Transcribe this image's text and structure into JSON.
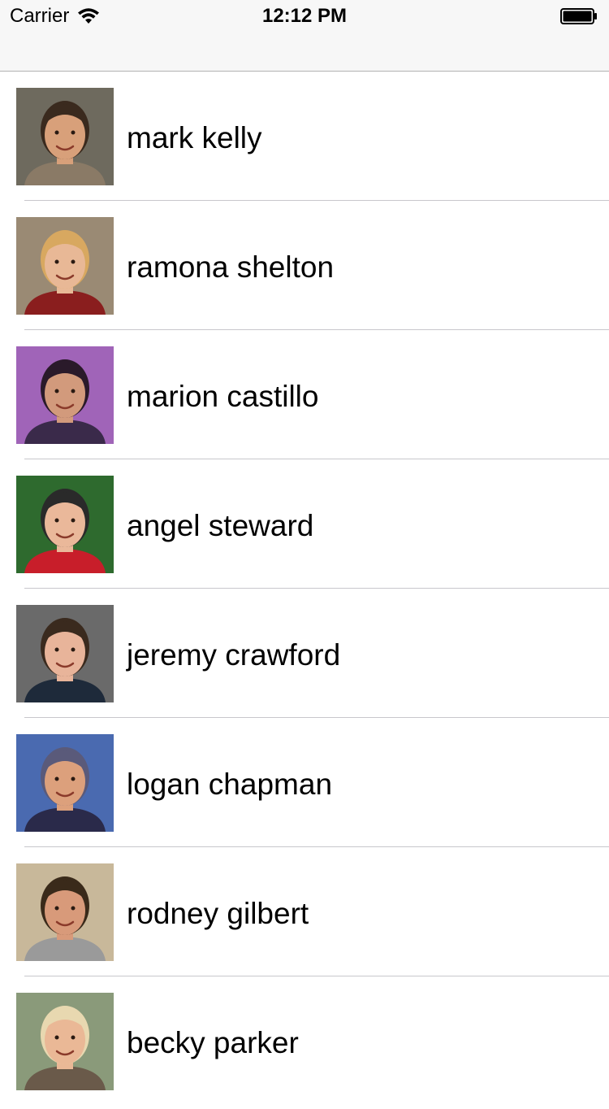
{
  "status_bar": {
    "carrier": "Carrier",
    "time": "12:12 PM"
  },
  "contacts": [
    {
      "name": "mark kelly",
      "bg": "#6e6a5e",
      "skin": "#d8a07a",
      "hair": "#3a2a1e",
      "shirt": "#8a7a66"
    },
    {
      "name": "ramona shelton",
      "bg": "#9a8a74",
      "skin": "#e8b896",
      "hair": "#d8a860",
      "shirt": "#8a1e1e"
    },
    {
      "name": "marion castillo",
      "bg": "#a064b8",
      "skin": "#d29a7c",
      "hair": "#2a1a2a",
      "shirt": "#3a2a4a"
    },
    {
      "name": "angel steward",
      "bg": "#2e6a2e",
      "skin": "#eab89a",
      "hair": "#2a2a2a",
      "shirt": "#c81e2a"
    },
    {
      "name": "jeremy crawford",
      "bg": "#6a6a6a",
      "skin": "#e8b49a",
      "hair": "#3a2a1e",
      "shirt": "#1e2a3a"
    },
    {
      "name": "logan chapman",
      "bg": "#4a6ab0",
      "skin": "#dca07c",
      "hair": "#5a5a7a",
      "shirt": "#2a2a4a"
    },
    {
      "name": "rodney gilbert",
      "bg": "#c8b89a",
      "skin": "#d89a7a",
      "hair": "#3a2a1a",
      "shirt": "#9a9a9a"
    },
    {
      "name": "becky parker",
      "bg": "#8a9a7a",
      "skin": "#eab896",
      "hair": "#e8d8b0",
      "shirt": "#6a5a4a"
    }
  ]
}
